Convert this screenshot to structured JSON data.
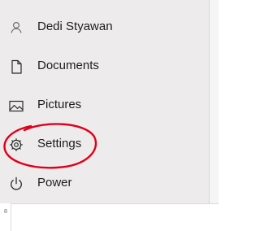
{
  "menu": {
    "items": [
      {
        "label": "Dedi Styawan",
        "icon": "user-icon"
      },
      {
        "label": "Documents",
        "icon": "document-icon"
      },
      {
        "label": "Pictures",
        "icon": "pictures-icon"
      },
      {
        "label": "Settings",
        "icon": "gear-icon"
      },
      {
        "label": "Power",
        "icon": "power-icon"
      }
    ]
  },
  "ruler": {
    "mark": "8"
  },
  "colors": {
    "panel_background": "#eeebed",
    "text": "#1c1c1c",
    "icon": "#2a2a2a",
    "annotation_circle": "#e0001a"
  }
}
